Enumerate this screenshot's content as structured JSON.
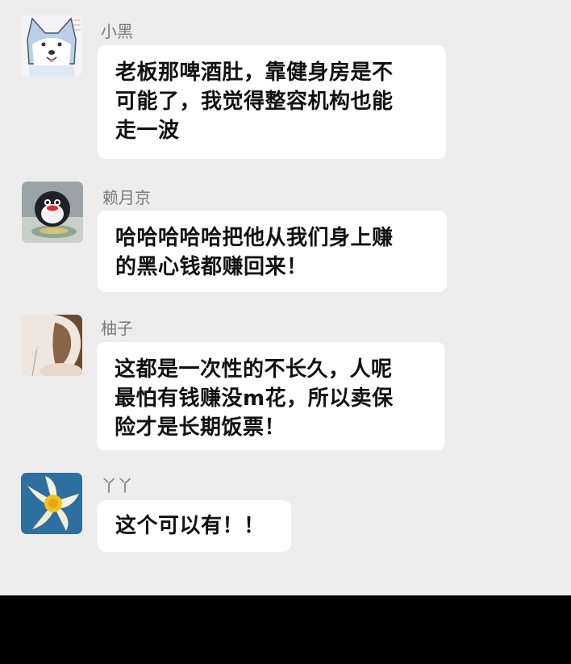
{
  "colors": {
    "chat_background": "#ededed",
    "bubble_background": "#ffffff",
    "sender_name": "#7a7a7a",
    "message_text": "#111111",
    "bottom_bar": "#000000"
  },
  "messages": [
    {
      "sender": "小黑",
      "avatar_icon": "cartoon-dog-avatar-icon",
      "lines": [
        "老板那啤酒肚，靠健身房是不",
        "可能了，我觉得整容机构也能",
        "走一波"
      ]
    },
    {
      "sender": "赖月京",
      "avatar_icon": "penguin-avatar-icon",
      "lines": [
        "哈哈哈哈哈把他从我们身上赚",
        "的黑心钱都赚回来！"
      ]
    },
    {
      "sender": "柚子",
      "avatar_icon": "woman-photo-avatar-icon",
      "lines": [
        "这都是一次性的不长久，人呢",
        "最怕有钱赚没m花，所以卖保",
        "险才是长期饭票！"
      ]
    },
    {
      "sender": "丫丫",
      "avatar_icon": "daffodil-flower-avatar-icon",
      "lines": [
        "这个可以有！！"
      ]
    }
  ]
}
